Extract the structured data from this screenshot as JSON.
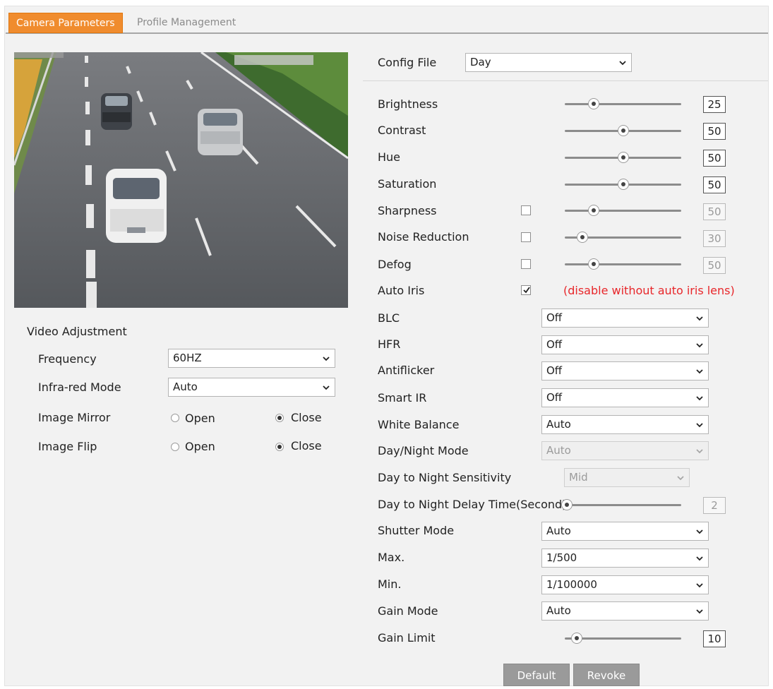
{
  "tabs": [
    {
      "label": "Camera Parameters",
      "active": true
    },
    {
      "label": "Profile Management",
      "active": false
    }
  ],
  "colors": {
    "accent": "#f08c2e",
    "warning": "#e8262a",
    "button": "#9a9a9a"
  },
  "video_adjustment": {
    "title": "Video Adjustment",
    "frequency": {
      "label": "Frequency",
      "value": "60HZ"
    },
    "infrared_mode": {
      "label": "Infra-red Mode",
      "value": "Auto"
    },
    "image_mirror": {
      "label": "Image Mirror",
      "open_label": "Open",
      "close_label": "Close",
      "selected": "Close"
    },
    "image_flip": {
      "label": "Image Flip",
      "open_label": "Open",
      "close_label": "Close",
      "selected": "Close"
    }
  },
  "config_file": {
    "label": "Config File",
    "value": "Day"
  },
  "params": {
    "brightness": {
      "label": "Brightness",
      "value": "25",
      "level": 25
    },
    "contrast": {
      "label": "Contrast",
      "value": "50",
      "level": 50
    },
    "hue": {
      "label": "Hue",
      "value": "50",
      "level": 50
    },
    "saturation": {
      "label": "Saturation",
      "value": "50",
      "level": 50
    },
    "sharpness": {
      "label": "Sharpness",
      "value": "50",
      "level": 50,
      "enabled": false
    },
    "noise_reduction": {
      "label": "Noise Reduction",
      "value": "30",
      "level": 30,
      "enabled": false
    },
    "defog": {
      "label": "Defog",
      "value": "50",
      "level": 50,
      "enabled": false
    },
    "auto_iris": {
      "label": "Auto Iris",
      "enabled": true,
      "note": "(disable without auto iris lens)"
    },
    "blc": {
      "label": "BLC",
      "value": "Off"
    },
    "hfr": {
      "label": "HFR",
      "value": "Off"
    },
    "antiflicker": {
      "label": "Antiflicker",
      "value": "Off"
    },
    "smart_ir": {
      "label": "Smart IR",
      "value": "Off"
    },
    "white_balance": {
      "label": "White Balance",
      "value": "Auto"
    },
    "day_night_mode": {
      "label": "Day/Night Mode",
      "value": "Auto"
    },
    "day_night_sensitivity": {
      "label": "Day to Night Sensitivity",
      "value": "Mid"
    },
    "day_night_delay": {
      "label": "Day to Night Delay Time(Second)",
      "value": "2",
      "level": 2
    },
    "shutter_mode": {
      "label": "Shutter Mode",
      "value": "Auto"
    },
    "max": {
      "label": "Max.",
      "value": "1/500"
    },
    "min": {
      "label": "Min.",
      "value": "1/100000"
    },
    "gain_mode": {
      "label": "Gain Mode",
      "value": "Auto"
    },
    "gain_limit": {
      "label": "Gain Limit",
      "value": "10",
      "level": 10
    }
  },
  "buttons": {
    "default_label": "Default",
    "revoke_label": "Revoke"
  }
}
